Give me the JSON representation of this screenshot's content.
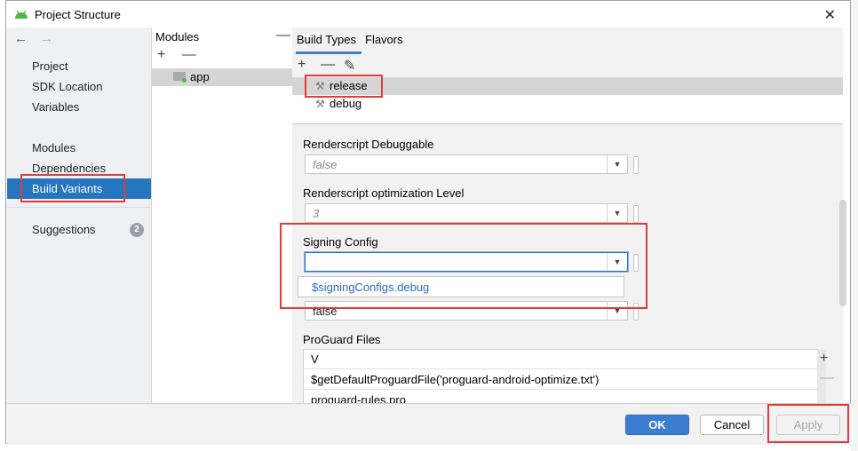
{
  "window": {
    "title": "Project Structure",
    "close_icon": "close-icon"
  },
  "nav": {
    "back": "←",
    "forward": "→",
    "items": [
      {
        "label": "Project"
      },
      {
        "label": "SDK Location"
      },
      {
        "label": "Variables"
      },
      {
        "label": "Modules"
      },
      {
        "label": "Dependencies"
      },
      {
        "label": "Build Variants",
        "selected": true
      },
      {
        "label": "Suggestions",
        "badge": "2"
      }
    ]
  },
  "modules": {
    "header": "Modules",
    "collapse": "—",
    "add": "+",
    "remove": "—",
    "items": [
      {
        "label": "app"
      }
    ]
  },
  "tabs": [
    {
      "label": "Build Types",
      "active": true
    },
    {
      "label": "Flavors"
    }
  ],
  "build_types": {
    "toolbar": {
      "add": "+",
      "remove": "—",
      "edit": "✎"
    },
    "items": [
      {
        "label": "release",
        "selected": true
      },
      {
        "label": "debug"
      }
    ]
  },
  "fields": {
    "renderscript_debuggable": {
      "label": "Renderscript Debuggable",
      "value": "false"
    },
    "renderscript_opt_level": {
      "label": "Renderscript optimization Level",
      "value": "3"
    },
    "signing_config": {
      "label": "Signing Config",
      "value": "",
      "options": [
        "$signingConfigs.debug"
      ]
    },
    "hidden_field": {
      "value": "false"
    }
  },
  "proguard": {
    "label": "ProGuard Files",
    "rows": [
      "V",
      "$getDefaultProguardFile('proguard-android-optimize.txt')",
      "proguard-rules.pro"
    ],
    "add": "+",
    "remove": "—"
  },
  "buttons": {
    "ok": "OK",
    "cancel": "Cancel",
    "apply": "Apply"
  },
  "colors": {
    "accent": "#2675bf",
    "highlight": "#e03c3c",
    "link": "#2a6bc4"
  }
}
